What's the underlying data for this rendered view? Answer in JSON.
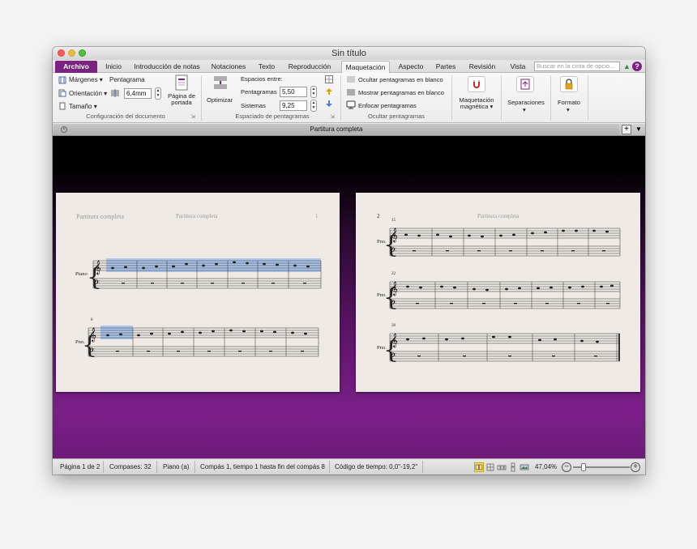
{
  "window": {
    "title": "Sin título"
  },
  "tabs": [
    {
      "label": "Archivo"
    },
    {
      "label": "Inicio"
    },
    {
      "label": "Introducción de notas"
    },
    {
      "label": "Notaciones"
    },
    {
      "label": "Texto"
    },
    {
      "label": "Reproducción"
    },
    {
      "label": "Maquetación"
    },
    {
      "label": "Aspecto"
    },
    {
      "label": "Partes"
    },
    {
      "label": "Revisión"
    },
    {
      "label": "Vista"
    }
  ],
  "search": {
    "placeholder": "Buscar en la cinta de opcio..."
  },
  "ribbon": {
    "doc_config": {
      "margins": "Márgenes",
      "staff_label": "Pentagrama",
      "orientation": "Orientación",
      "staff_size": "6,4mm",
      "size": "Tamaño",
      "title_page": "Página de portada",
      "group_label": "Configuración del documento"
    },
    "staff_spacing": {
      "optimize": "Optimizar",
      "spaces_between": "Espacios entre:",
      "staves_label": "Pentagramas",
      "staves_value": "5,50",
      "systems_label": "Sistemas",
      "systems_value": "9,25",
      "group_label": "Espaciado de pentagramas"
    },
    "hide_staves": {
      "hide_empty": "Ocultar pentagramas en blanco",
      "show_empty": "Mostrar pentagramas en blanco",
      "focus": "Enfocar pentagramas",
      "group_label": "Ocultar pentagramas"
    },
    "magnetic": {
      "label": "Maquetación magnética"
    },
    "breaks": {
      "label": "Separaciones"
    },
    "format": {
      "label": "Formato"
    }
  },
  "document_tab": {
    "label": "Partitura completa"
  },
  "pages": {
    "left": {
      "header_left": "Partitura completa",
      "header_center": "Partitura completa",
      "page_number": "1",
      "instrument_1": "Piano",
      "instrument_2": "Pno.",
      "bar_number_2": "8"
    },
    "right": {
      "page_number": "2",
      "header_center": "Partitura completa",
      "instrument": "Pno.",
      "bar_numbers": [
        "15",
        "22",
        "28"
      ]
    }
  },
  "status": {
    "page": "Página 1 de 2",
    "bars": "Compases: 32",
    "instrument": "Piano (a)",
    "position": "Compás 1, tiempo 1 hasta fin del compás 8",
    "timecode": "Código de tiempo: 0,0\"-19,2\"",
    "zoom": "47,04%"
  },
  "colors": {
    "accent": "#7a2380",
    "selection": "#8fb6ec"
  }
}
